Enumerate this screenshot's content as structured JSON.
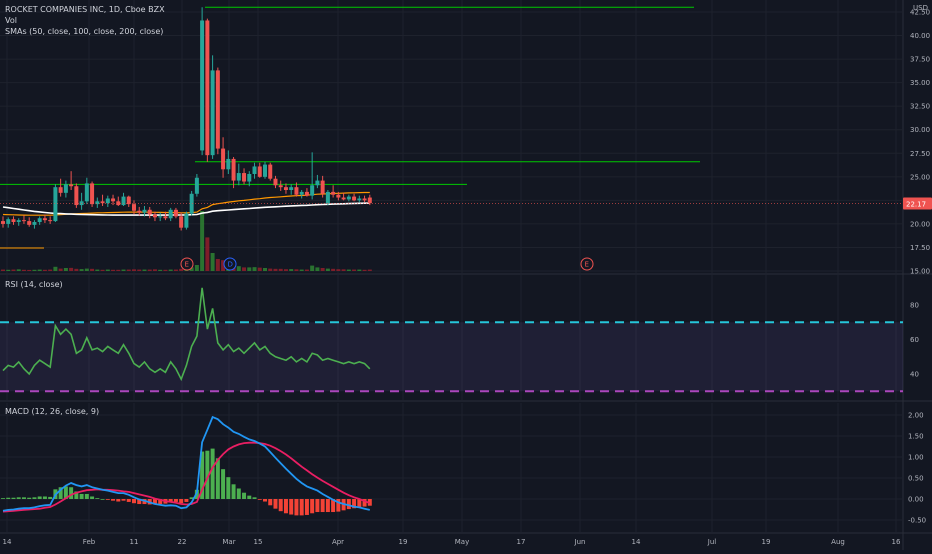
{
  "price_pane": {
    "title": "ROCKET COMPANIES INC, 1D, Cboe BZX",
    "vol_label": "Vol",
    "sma_label": "SMAs (50, close, 100, close, 200, close)",
    "currency": "USD",
    "last_price": "22.17",
    "last_price_color": "#ef5350",
    "y_ticks": [
      "42.50",
      "40.00",
      "37.50",
      "35.00",
      "32.50",
      "30.00",
      "27.50",
      "25.00",
      "22.50",
      "20.00",
      "17.50",
      "15.00"
    ],
    "event_markers": [
      "E",
      "D",
      "E"
    ]
  },
  "rsi_pane": {
    "label": "RSI (14, close)",
    "y_ticks": [
      "80",
      "60",
      "40"
    ],
    "upper_band": 70,
    "lower_band": 30,
    "line_color": "#4caf50"
  },
  "macd_pane": {
    "label": "MACD (12, 26, close, 9)",
    "y_ticks": [
      "2.00",
      "1.50",
      "1.00",
      "0.50",
      "0.00",
      "-0.50"
    ],
    "macd_color": "#2196f3",
    "signal_color": "#e91e63",
    "hist_up_color": "#4caf50",
    "hist_down_color": "#f44336"
  },
  "x_axis": {
    "labels": [
      "14",
      "Feb",
      "11",
      "22",
      "Mar",
      "15",
      "Apr",
      "19",
      "May",
      "17",
      "Jun",
      "14",
      "Jul",
      "19",
      "Aug",
      "16"
    ]
  },
  "colors": {
    "up": "#26a69a",
    "down": "#ef5350",
    "sma50": "#ff9800",
    "sma100": "#ffffff",
    "hline": "#00c800"
  },
  "chart_data": [
    {
      "type": "candlestick",
      "title": "ROCKET COMPANIES INC, 1D, Cboe BZX",
      "ylim": [
        15,
        43
      ],
      "ohlc": [
        [
          20.3,
          20.8,
          19.6,
          20.0
        ],
        [
          20.0,
          20.7,
          19.6,
          20.5
        ],
        [
          20.5,
          20.8,
          19.9,
          20.2
        ],
        [
          20.2,
          20.6,
          19.8,
          20.4
        ],
        [
          20.4,
          20.9,
          20.0,
          20.3
        ],
        [
          20.3,
          20.7,
          19.7,
          19.9
        ],
        [
          19.9,
          20.4,
          19.5,
          20.2
        ],
        [
          20.2,
          20.8,
          19.9,
          20.6
        ],
        [
          20.6,
          21.0,
          20.1,
          20.4
        ],
        [
          20.4,
          20.8,
          20.0,
          20.3
        ],
        [
          20.3,
          24.2,
          20.2,
          23.9
        ],
        [
          23.9,
          24.8,
          22.9,
          23.3
        ],
        [
          23.3,
          24.6,
          22.8,
          24.2
        ],
        [
          24.2,
          25.6,
          23.6,
          24.0
        ],
        [
          24.0,
          24.3,
          21.7,
          22.0
        ],
        [
          22.0,
          23.3,
          21.5,
          22.4
        ],
        [
          22.4,
          24.9,
          22.1,
          24.3
        ],
        [
          24.3,
          24.5,
          21.8,
          22.1
        ],
        [
          22.1,
          22.8,
          21.7,
          22.4
        ],
        [
          22.4,
          23.1,
          21.9,
          22.2
        ],
        [
          22.2,
          23.0,
          21.8,
          22.7
        ],
        [
          22.7,
          23.1,
          22.0,
          22.4
        ],
        [
          22.4,
          22.9,
          21.9,
          22.0
        ],
        [
          22.0,
          23.3,
          21.9,
          22.9
        ],
        [
          22.9,
          23.0,
          21.8,
          22.1
        ],
        [
          22.1,
          22.5,
          21.0,
          21.4
        ],
        [
          21.4,
          21.8,
          20.9,
          21.2
        ],
        [
          21.2,
          21.9,
          20.8,
          21.5
        ],
        [
          21.5,
          21.8,
          20.6,
          21.0
        ],
        [
          21.0,
          21.3,
          20.3,
          20.7
        ],
        [
          20.7,
          21.2,
          20.3,
          20.8
        ],
        [
          20.8,
          21.3,
          20.4,
          20.6
        ],
        [
          20.6,
          21.7,
          20.3,
          21.5
        ],
        [
          21.5,
          21.7,
          20.6,
          20.8
        ],
        [
          20.8,
          21.2,
          19.3,
          19.6
        ],
        [
          19.6,
          21.3,
          19.4,
          21.1
        ],
        [
          21.1,
          23.5,
          20.9,
          23.2
        ],
        [
          23.2,
          25.3,
          22.9,
          24.9
        ],
        [
          27.8,
          43.0,
          27.3,
          41.6
        ],
        [
          41.6,
          41.8,
          26.6,
          27.3
        ],
        [
          27.3,
          37.9,
          26.9,
          36.3
        ],
        [
          36.3,
          36.6,
          27.4,
          28.0
        ],
        [
          28.0,
          29.2,
          24.9,
          25.8
        ],
        [
          25.8,
          27.8,
          25.3,
          26.9
        ],
        [
          26.9,
          27.1,
          23.8,
          24.6
        ],
        [
          24.6,
          26.4,
          24.1,
          25.4
        ],
        [
          25.4,
          25.9,
          24.2,
          24.5
        ],
        [
          24.5,
          25.6,
          24.0,
          25.3
        ],
        [
          25.3,
          26.5,
          24.8,
          26.1
        ],
        [
          26.1,
          26.5,
          24.9,
          25.0
        ],
        [
          25.0,
          26.6,
          24.8,
          26.3
        ],
        [
          26.3,
          26.5,
          24.6,
          24.8
        ],
        [
          24.8,
          25.1,
          23.8,
          24.1
        ],
        [
          24.1,
          24.6,
          23.5,
          23.9
        ],
        [
          23.9,
          24.3,
          23.2,
          23.6
        ],
        [
          23.6,
          24.2,
          23.1,
          23.9
        ],
        [
          23.9,
          24.4,
          22.9,
          23.1
        ],
        [
          23.1,
          23.6,
          22.7,
          23.4
        ],
        [
          23.4,
          23.8,
          22.9,
          23.0
        ],
        [
          23.0,
          27.6,
          22.6,
          24.1
        ],
        [
          24.1,
          25.2,
          23.8,
          24.6
        ],
        [
          24.6,
          25.1,
          22.8,
          23.2
        ],
        [
          22.2,
          23.6,
          22.0,
          23.4
        ],
        [
          23.4,
          24.1,
          22.8,
          23.1
        ],
        [
          23.1,
          23.4,
          22.5,
          22.8
        ],
        [
          22.8,
          23.3,
          22.5,
          22.6
        ],
        [
          22.6,
          23.1,
          22.4,
          22.9
        ],
        [
          22.9,
          23.2,
          22.4,
          22.5
        ],
        [
          22.5,
          23.0,
          22.3,
          22.7
        ],
        [
          22.7,
          23.0,
          22.3,
          22.5
        ],
        [
          22.8,
          23.1,
          22.0,
          22.2
        ]
      ],
      "volume_rel": [
        0.12,
        0.1,
        0.12,
        0.14,
        0.1,
        0.09,
        0.1,
        0.12,
        0.1,
        0.12,
        0.35,
        0.2,
        0.25,
        0.26,
        0.18,
        0.16,
        0.2,
        0.18,
        0.12,
        0.1,
        0.12,
        0.1,
        0.1,
        0.12,
        0.12,
        0.14,
        0.12,
        0.12,
        0.12,
        0.14,
        0.1,
        0.1,
        0.12,
        0.12,
        0.18,
        0.2,
        0.3,
        0.5,
        5.0,
        2.8,
        1.5,
        1.0,
        0.9,
        0.7,
        0.5,
        0.4,
        0.3,
        0.3,
        0.32,
        0.28,
        0.25,
        0.2,
        0.18,
        0.18,
        0.15,
        0.16,
        0.14,
        0.12,
        0.12,
        0.45,
        0.3,
        0.25,
        0.2,
        0.18,
        0.15,
        0.14,
        0.12,
        0.12,
        0.12,
        0.1,
        0.12
      ],
      "sma50": [
        21.0,
        20.98,
        20.97,
        20.95,
        20.94,
        20.93,
        20.92,
        20.92,
        20.92,
        20.92,
        20.95,
        20.98,
        21.02,
        21.06,
        21.08,
        21.1,
        21.13,
        21.15,
        21.17,
        21.18,
        21.2,
        21.21,
        21.22,
        21.24,
        21.25,
        21.25,
        21.25,
        21.25,
        21.24,
        21.23,
        21.22,
        21.21,
        21.21,
        21.2,
        21.18,
        21.18,
        21.2,
        21.25,
        21.6,
        21.75,
        22.05,
        22.15,
        22.22,
        22.32,
        22.38,
        22.45,
        22.5,
        22.56,
        22.63,
        22.68,
        22.75,
        22.8,
        22.84,
        22.88,
        22.92,
        22.96,
        22.99,
        23.02,
        23.05,
        23.1,
        23.15,
        23.18,
        23.2,
        23.23,
        23.25,
        23.27,
        23.29,
        23.3,
        23.32,
        23.33,
        23.34
      ],
      "sma100": [
        21.8,
        21.72,
        21.64,
        21.56,
        21.48,
        21.4,
        21.33,
        21.27,
        21.21,
        21.16,
        21.12,
        21.09,
        21.06,
        21.04,
        21.02,
        21.0,
        20.99,
        20.98,
        20.97,
        20.96,
        20.95,
        20.94,
        20.94,
        20.94,
        20.94,
        20.94,
        20.94,
        20.94,
        20.94,
        20.94,
        20.94,
        20.94,
        20.95,
        20.95,
        20.95,
        20.96,
        20.98,
        21.0,
        21.15,
        21.22,
        21.35,
        21.4,
        21.44,
        21.48,
        21.52,
        21.56,
        21.6,
        21.64,
        21.68,
        21.72,
        21.76,
        21.79,
        21.82,
        21.85,
        21.88,
        21.91,
        21.93,
        21.96,
        21.98,
        22.01,
        22.04,
        22.06,
        22.08,
        22.1,
        22.12,
        22.14,
        22.16,
        22.18,
        22.19,
        22.2,
        22.21
      ],
      "horizontal_levels": [
        43.0,
        26.6,
        24.2
      ]
    },
    {
      "type": "line",
      "title": "RSI (14, close)",
      "values": [
        42,
        45,
        44,
        47,
        43,
        40,
        45,
        48,
        46,
        44,
        68,
        63,
        66,
        63,
        52,
        54,
        61,
        54,
        55,
        53,
        56,
        54,
        52,
        57,
        52,
        46,
        44,
        47,
        43,
        41,
        43,
        41,
        47,
        43,
        37,
        45,
        56,
        62,
        90,
        66,
        78,
        58,
        54,
        57,
        53,
        55,
        52,
        55,
        58,
        54,
        56,
        52,
        50,
        49,
        48,
        50,
        47,
        49,
        47,
        52,
        51,
        48,
        49,
        48,
        47,
        46,
        47,
        46,
        47,
        46,
        43
      ],
      "ylim": [
        25,
        92
      ],
      "bands": [
        70,
        30
      ]
    },
    {
      "type": "line",
      "title": "MACD (12, 26, close, 9)",
      "macd": [
        -0.28,
        -0.26,
        -0.25,
        -0.23,
        -0.22,
        -0.22,
        -0.2,
        -0.17,
        -0.15,
        -0.14,
        0.1,
        0.22,
        0.32,
        0.38,
        0.33,
        0.3,
        0.33,
        0.28,
        0.25,
        0.22,
        0.2,
        0.17,
        0.14,
        0.14,
        0.1,
        0.04,
        -0.01,
        -0.04,
        -0.08,
        -0.12,
        -0.14,
        -0.16,
        -0.15,
        -0.16,
        -0.22,
        -0.2,
        -0.08,
        0.15,
        1.35,
        1.65,
        1.95,
        1.9,
        1.78,
        1.7,
        1.6,
        1.55,
        1.48,
        1.42,
        1.38,
        1.32,
        1.25,
        1.12,
        0.98,
        0.85,
        0.72,
        0.6,
        0.48,
        0.38,
        0.3,
        0.25,
        0.2,
        0.12,
        0.05,
        -0.02,
        -0.08,
        -0.12,
        -0.15,
        -0.18,
        -0.2,
        -0.23,
        -0.26
      ],
      "signal": [
        -0.3,
        -0.29,
        -0.28,
        -0.27,
        -0.26,
        -0.25,
        -0.24,
        -0.23,
        -0.21,
        -0.19,
        -0.13,
        -0.06,
        0.02,
        0.1,
        0.15,
        0.18,
        0.21,
        0.22,
        0.23,
        0.22,
        0.22,
        0.21,
        0.2,
        0.18,
        0.17,
        0.14,
        0.11,
        0.08,
        0.05,
        0.01,
        -0.02,
        -0.05,
        -0.07,
        -0.09,
        -0.12,
        -0.13,
        -0.12,
        -0.07,
        0.22,
        0.5,
        0.75,
        0.93,
        1.07,
        1.18,
        1.25,
        1.3,
        1.33,
        1.34,
        1.34,
        1.33,
        1.31,
        1.27,
        1.21,
        1.14,
        1.06,
        0.97,
        0.87,
        0.77,
        0.68,
        0.59,
        0.51,
        0.43,
        0.36,
        0.29,
        0.22,
        0.15,
        0.09,
        0.04,
        0.0,
        -0.05,
        -0.1
      ],
      "ylim": [
        -0.6,
        2.1
      ]
    }
  ]
}
